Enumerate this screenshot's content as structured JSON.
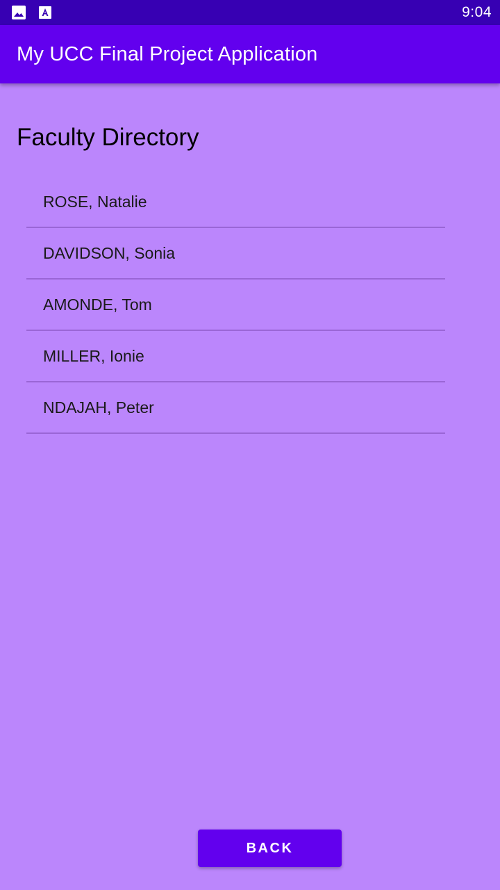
{
  "status_bar": {
    "time": "9:04",
    "icons": [
      "image-icon",
      "font-download-icon"
    ]
  },
  "app_bar": {
    "title": "My UCC Final Project Application"
  },
  "page": {
    "title": "Faculty Directory"
  },
  "faculty_list": [
    {
      "name": "ROSE, Natalie"
    },
    {
      "name": "DAVIDSON, Sonia"
    },
    {
      "name": "AMONDE, Tom"
    },
    {
      "name": "MILLER, Ionie"
    },
    {
      "name": "NDAJAH, Peter"
    }
  ],
  "actions": {
    "back_label": "BACK"
  },
  "colors": {
    "status_bar": "#3700b3",
    "app_bar": "#6200ee",
    "background": "#bb86fc",
    "divider": "#9a66d6",
    "button": "#6200ee"
  }
}
